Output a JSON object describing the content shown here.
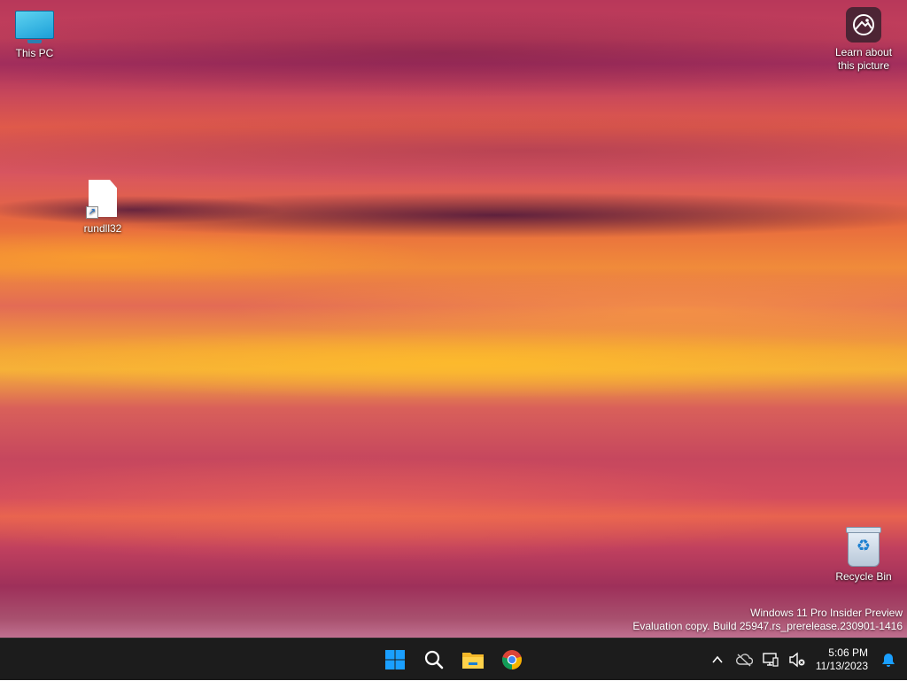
{
  "desktop": {
    "icons": {
      "this_pc": "This PC",
      "rundll32": "rundll32",
      "recycle_bin": "Recycle Bin",
      "learn_line1": "Learn about",
      "learn_line2": "this picture"
    },
    "watermark": {
      "line1": "Windows 11 Pro Insider Preview",
      "line2": "Evaluation copy. Build 25947.rs_prerelease.230901-1416"
    }
  },
  "taskbar": {
    "pinned": [
      {
        "name": "start",
        "icon": "windows-logo-icon"
      },
      {
        "name": "search",
        "icon": "search-icon"
      },
      {
        "name": "file-explorer",
        "icon": "folder-icon"
      },
      {
        "name": "chrome",
        "icon": "chrome-icon"
      }
    ],
    "tray": {
      "icons": [
        "chevron-up-icon",
        "cloud-offline-icon",
        "network-icon",
        "volume-muted-icon",
        "bell-icon"
      ],
      "time": "5:06 PM",
      "date": "11/13/2023"
    },
    "colors": {
      "bar": "#1c1c1c",
      "accent": "#1a9fff"
    }
  }
}
